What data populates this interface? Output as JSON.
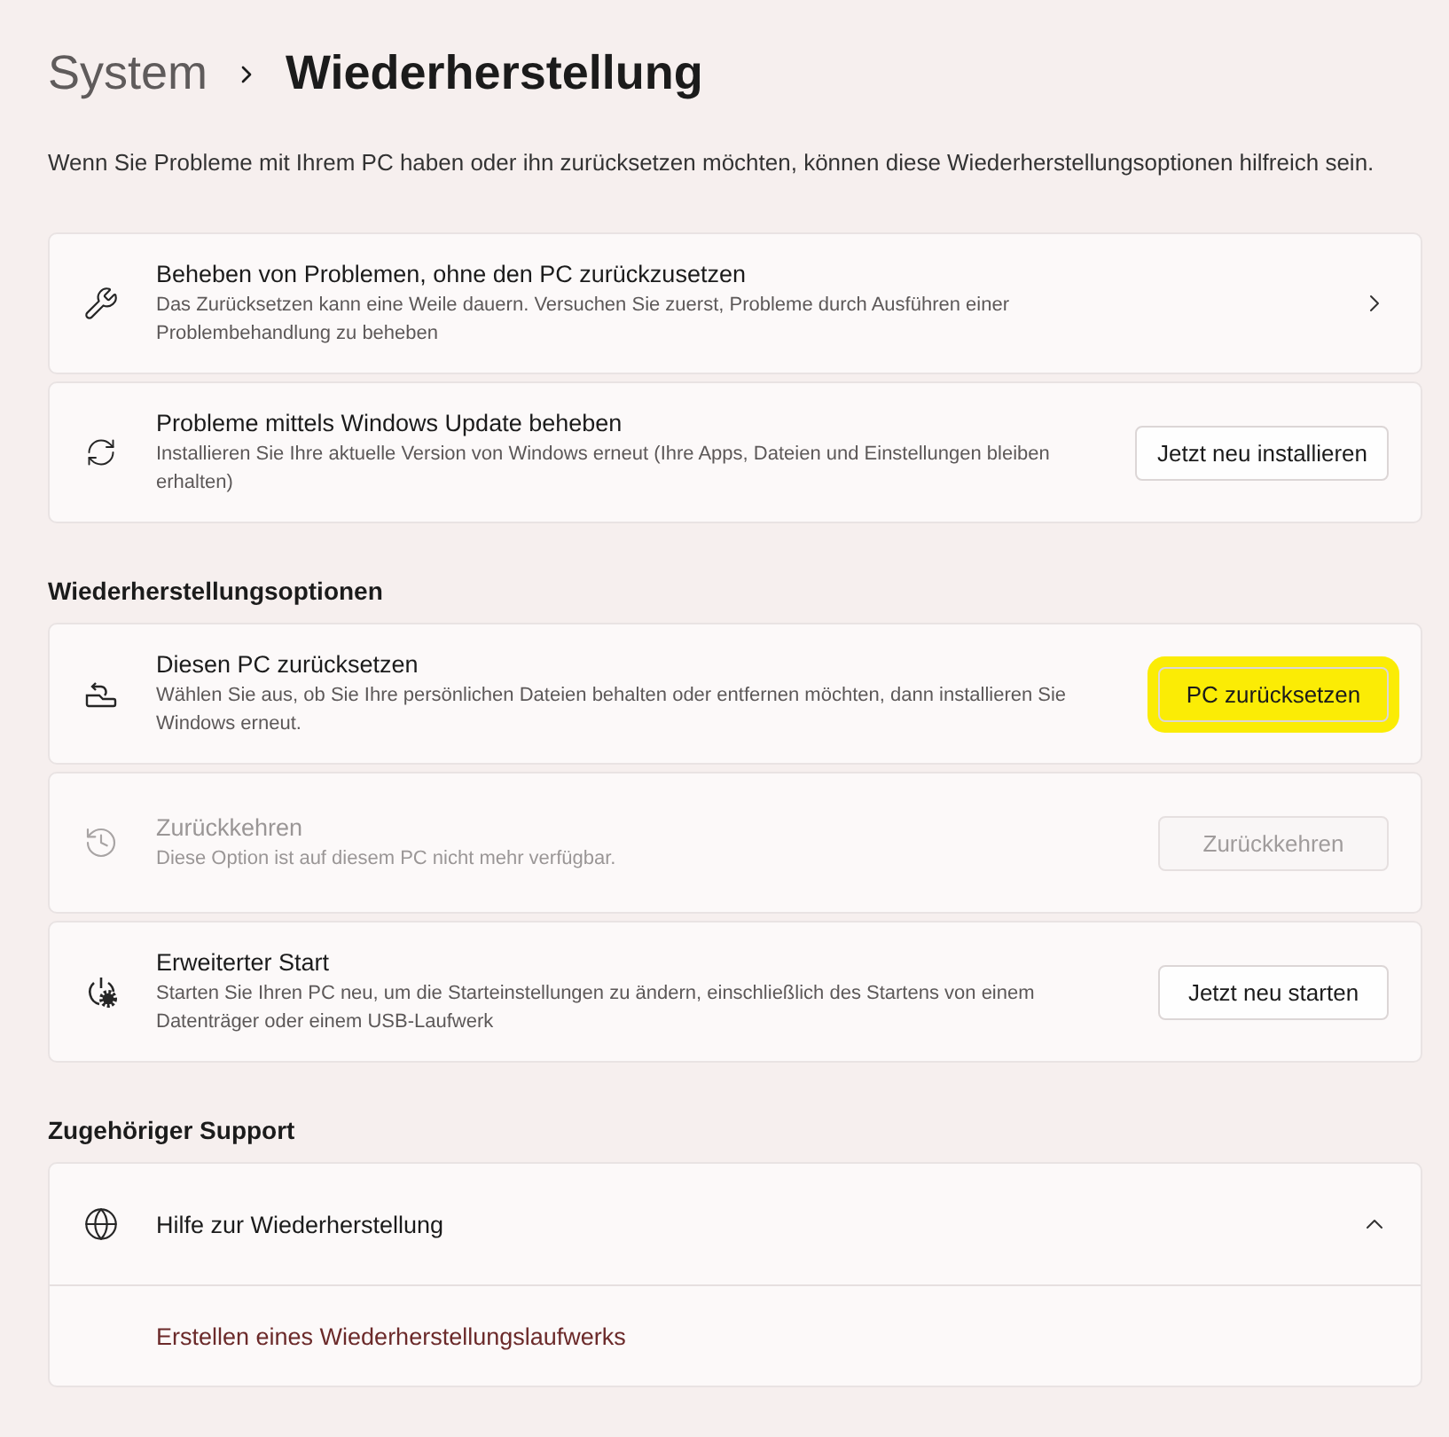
{
  "breadcrumb": {
    "parent": "System",
    "current": "Wiederherstellung"
  },
  "description": "Wenn Sie Probleme mit Ihrem PC haben oder ihn zurücksetzen möchten, können diese Wiederherstellungsoptionen hilfreich sein.",
  "sections": [
    {
      "items": [
        {
          "title": "Beheben von Problemen, ohne den PC zurückzusetzen",
          "subtitle": "Das Zurücksetzen kann eine Weile dauern. Versuchen Sie zuerst, Probleme durch Ausführen einer Problembehandlung zu beheben",
          "kind": "link",
          "disabled": false
        },
        {
          "title": "Probleme mittels Windows Update beheben",
          "subtitle": "Installieren Sie Ihre aktuelle Version von Windows erneut (Ihre Apps, Dateien und Einstellungen bleiben erhalten)",
          "kind": "button",
          "button": "Jetzt neu installieren",
          "highlighted": false,
          "disabled": false
        }
      ]
    },
    {
      "heading": "Wiederherstellungsoptionen",
      "items": [
        {
          "title": "Diesen PC zurücksetzen",
          "subtitle": "Wählen Sie aus, ob Sie Ihre persönlichen Dateien behalten oder entfernen möchten, dann installieren Sie Windows erneut.",
          "kind": "button",
          "button": "PC zurücksetzen",
          "highlighted": true,
          "disabled": false
        },
        {
          "title": "Zurückkehren",
          "subtitle": "Diese Option ist auf diesem PC nicht mehr verfügbar.",
          "kind": "button",
          "button": "Zurückkehren",
          "highlighted": false,
          "disabled": true
        },
        {
          "title": "Erweiterter Start",
          "subtitle": "Starten Sie Ihren PC neu, um die Starteinstellungen zu ändern, einschließlich des Startens von einem Datenträger oder einem USB-Laufwerk",
          "kind": "button",
          "button": "Jetzt neu starten",
          "highlighted": false,
          "disabled": false
        }
      ]
    },
    {
      "heading": "Zugehöriger Support",
      "items": [
        {
          "title": "Hilfe zur Wiederherstellung",
          "kind": "expander",
          "expanded": true,
          "disabled": false,
          "links": [
            "Erstellen eines Wiederherstellungslaufwerks"
          ]
        }
      ]
    }
  ]
}
